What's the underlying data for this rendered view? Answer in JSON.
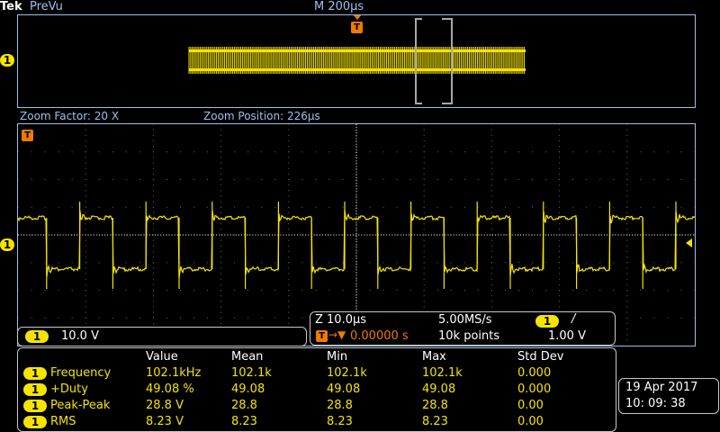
{
  "header": {
    "brand": "Tek",
    "mode": "PreVu",
    "timebase": "M 200µs"
  },
  "zoom": {
    "factor_label": "Zoom Factor: 20 X",
    "position_label": "Zoom Position: 226µs"
  },
  "channel": {
    "number": "1",
    "scale": "10.0 V",
    "color": "#f5e400"
  },
  "trigger_marker": "T",
  "acquisition": {
    "zoom_scale": "Z 10.0µs",
    "sample_rate": "5.00MS/s",
    "trigger_channel": "1",
    "trigger_slope": "/",
    "trigger_position": "0.00000 s",
    "record_length": "10k points",
    "trigger_level": "1.00 V"
  },
  "measurements": {
    "headers": [
      "Value",
      "Mean",
      "Min",
      "Max",
      "Std Dev"
    ],
    "rows": [
      {
        "ch": "1",
        "name": "Frequency",
        "value": "102.1kHz",
        "mean": "102.1k",
        "min": "102.1k",
        "max": "102.1k",
        "std": "0.000"
      },
      {
        "ch": "1",
        "name": "+Duty",
        "value": "49.08 %",
        "mean": "49.08",
        "min": "49.08",
        "max": "49.08",
        "std": "0.000"
      },
      {
        "ch": "1",
        "name": "Peak-Peak",
        "value": "28.8 V",
        "mean": "28.8",
        "min": "28.8",
        "max": "28.8",
        "std": "0.00"
      },
      {
        "ch": "1",
        "name": "RMS",
        "value": "8.23 V",
        "mean": "8.23",
        "min": "8.23",
        "max": "8.23",
        "std": "0.00"
      }
    ]
  },
  "clock": {
    "date": "19 Apr   2017",
    "time": "10: 09: 38"
  }
}
